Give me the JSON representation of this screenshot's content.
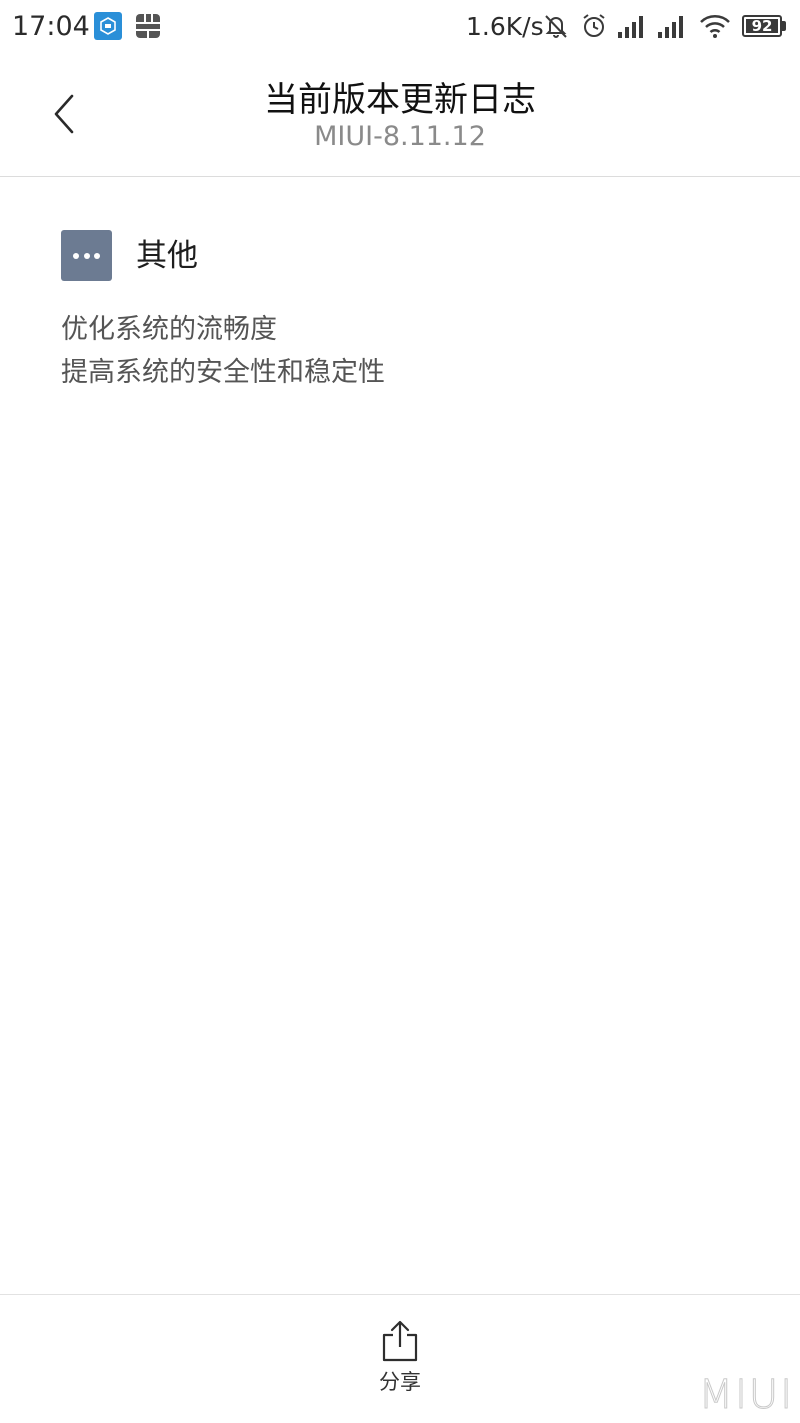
{
  "status_bar": {
    "time": "17:04",
    "net_speed": "1.6K/s",
    "battery_level": "92",
    "icons": [
      "app-notification-icon",
      "sim-card-icon",
      "mute-icon",
      "alarm-icon",
      "signal-icon",
      "signal-icon",
      "wifi-icon",
      "battery-icon"
    ]
  },
  "header": {
    "title": "当前版本更新日志",
    "subtitle": "MIUI-8.11.12",
    "back_icon": "chevron-left-icon"
  },
  "section": {
    "icon": "more-dots-icon",
    "title": "其他",
    "notes": [
      "优化系统的流畅度",
      "提高系统的安全性和稳定性"
    ]
  },
  "bottom_bar": {
    "share_label": "分享",
    "share_icon": "share-icon"
  },
  "watermark": "MIUI",
  "colors": {
    "section_icon_bg": "#6c7b92",
    "app_icon_bg": "#2a8fd8"
  }
}
